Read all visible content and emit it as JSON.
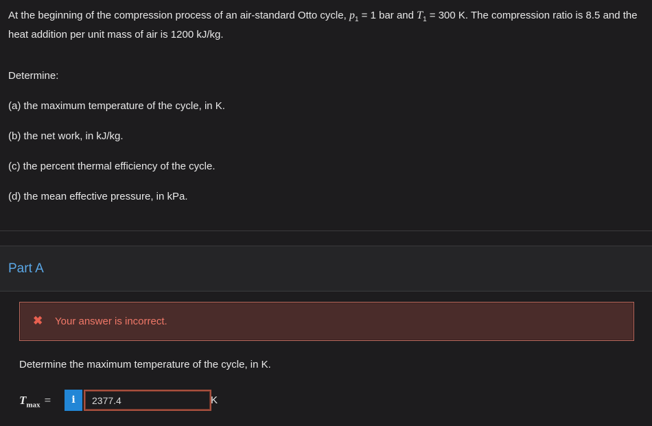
{
  "problem": {
    "intro_parts": {
      "p1": "At the beginning of the compression process of an air-standard Otto cycle, ",
      "p_sym": "p",
      "p_sub": "1",
      "p2": " = 1 bar and ",
      "t_sym": "T",
      "t_sub": "1",
      "p3": " = 300 K. The compression ratio is 8.5 and the heat addition per unit mass of air is 1200 kJ/kg."
    },
    "determine": "Determine:",
    "items": [
      "(a) the maximum temperature of the cycle, in K.",
      "(b) the net work, in kJ/kg.",
      "(c) the percent thermal efficiency of the cycle.",
      "(d) the mean effective pressure, in kPa."
    ]
  },
  "part": {
    "title": "Part A",
    "error_message": "Your answer is incorrect.",
    "question": "Determine the maximum temperature of the cycle, in K.",
    "variable_symbol": "T",
    "variable_subscript": "max",
    "equals": "=",
    "info_glyph": "i",
    "answer_value": "2377.4",
    "unit": "K"
  },
  "colors": {
    "accent": "#5aa7e6",
    "error": "#f07868",
    "info_button": "#2286d6"
  }
}
